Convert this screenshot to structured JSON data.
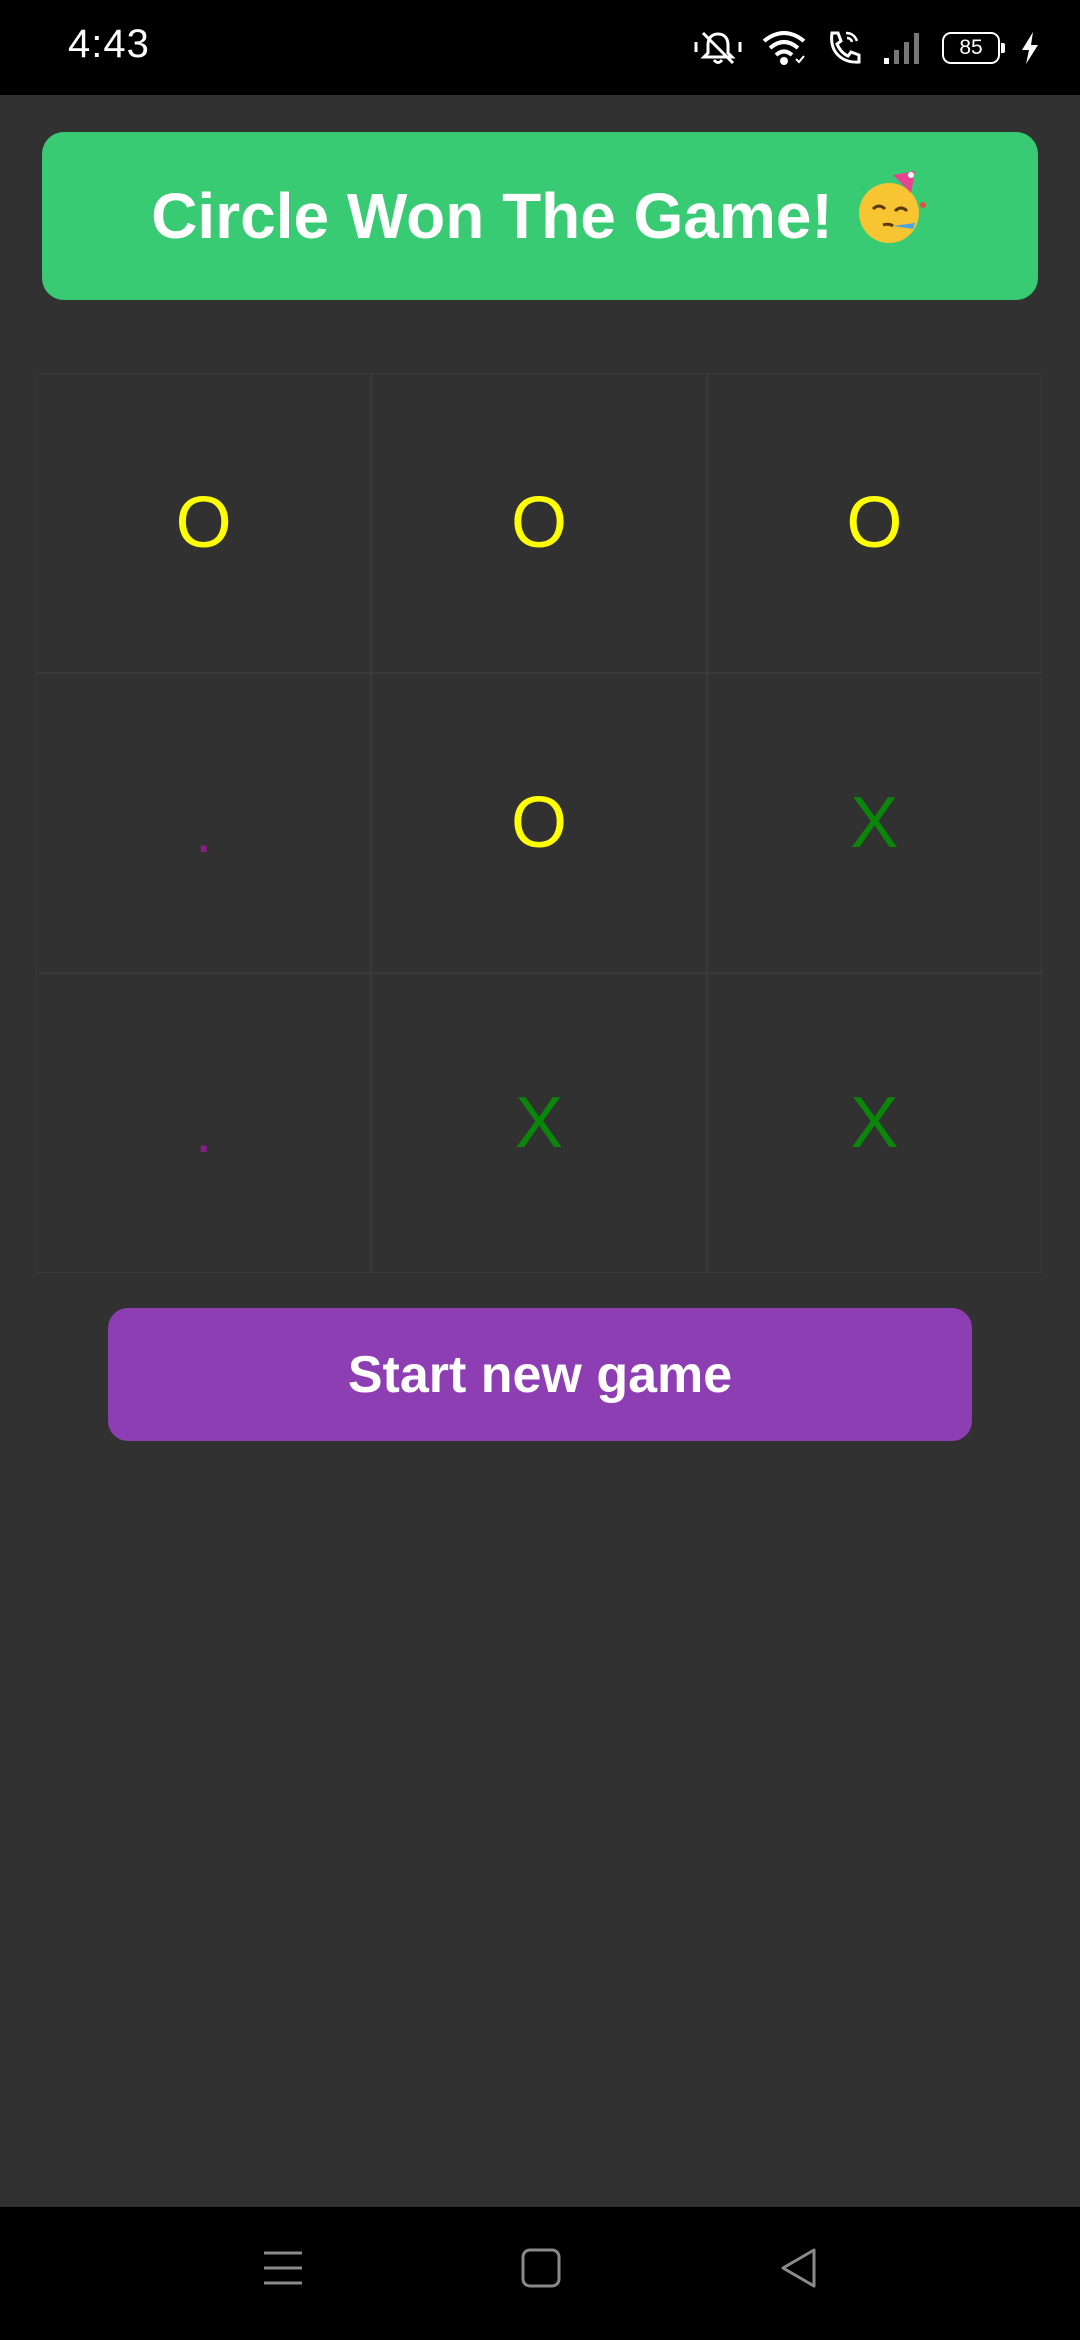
{
  "status_bar": {
    "time": "4:43",
    "battery_level": "85",
    "icons": [
      "bell-off-icon",
      "wifi-icon",
      "wifi-call-icon",
      "signal-icon",
      "battery-icon",
      "charging-icon"
    ]
  },
  "banner": {
    "text": "Circle Won The Game!",
    "emoji": "🥳",
    "color": "#39ca74"
  },
  "board": {
    "cells": [
      {
        "value": "O",
        "state": "o"
      },
      {
        "value": "O",
        "state": "o"
      },
      {
        "value": "O",
        "state": "o"
      },
      {
        "value": ".",
        "state": "empty"
      },
      {
        "value": "O",
        "state": "o"
      },
      {
        "value": "X",
        "state": "x"
      },
      {
        "value": ".",
        "state": "empty"
      },
      {
        "value": "X",
        "state": "x"
      },
      {
        "value": "X",
        "state": "x"
      }
    ],
    "colors": {
      "o": "#ffff00",
      "x": "#0a870a",
      "empty": "#8a1d8a"
    }
  },
  "actions": {
    "new_game_label": "Start new game",
    "new_game_color": "#8e3eb3"
  },
  "nav_bar": {
    "icons": [
      "menu-icon",
      "home-icon",
      "back-icon"
    ]
  }
}
